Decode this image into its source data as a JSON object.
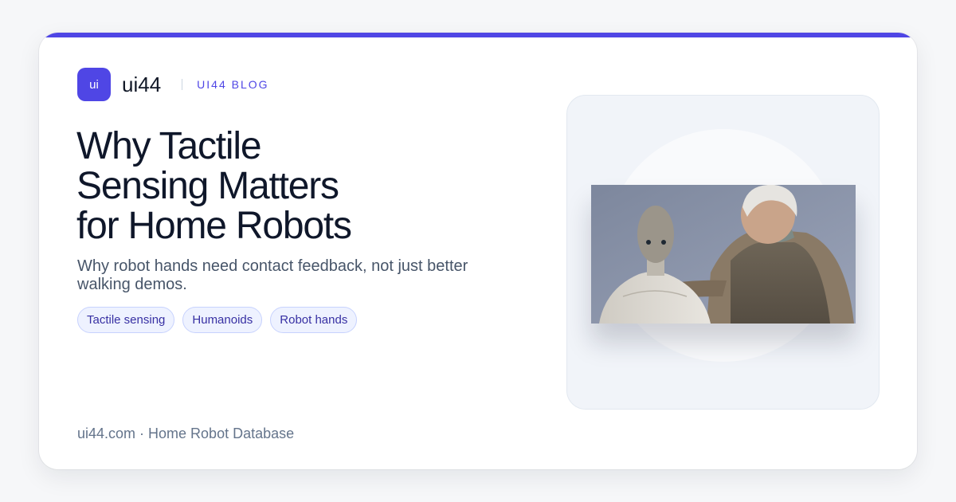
{
  "brand": {
    "logo_text": "ui",
    "name": "ui44",
    "section_label": "UI44 BLOG"
  },
  "post": {
    "title_lines": [
      "Why Tactile",
      "Sensing Matters",
      "for Home Robots"
    ],
    "subtitle": "Why robot hands need contact feedback, not just better walking demos.",
    "tags": [
      "Tactile sensing",
      "Humanoids",
      "Robot hands"
    ]
  },
  "footer": {
    "text": "ui44.com · Home Robot Database"
  },
  "image": {
    "subject": "photo-humanoid-robot-and-older-man"
  },
  "colors": {
    "accent": "#4f46e5",
    "title": "#0f172a",
    "muted": "#64748b",
    "tag_bg": "#eef2ff"
  }
}
